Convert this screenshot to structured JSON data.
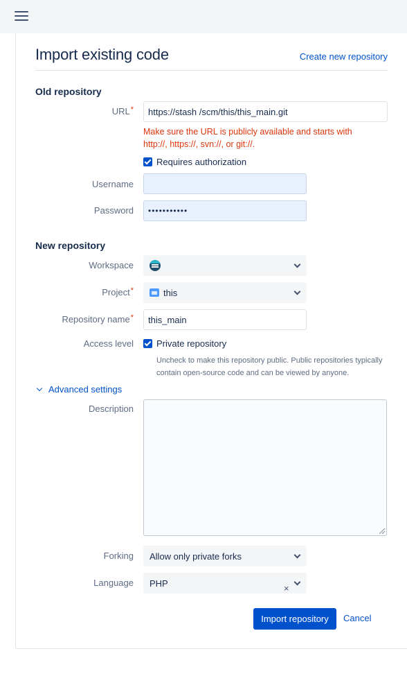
{
  "header": {
    "menu_icon": "hamburger-menu-icon"
  },
  "page": {
    "title": "Import existing code",
    "create_link": "Create new repository"
  },
  "old_repository": {
    "section_title": "Old repository",
    "url_label": "URL",
    "url_value": "https://stash        /scm/this/this_main.git",
    "error_text": "Make sure the URL is publicly available and starts with http://, https://, svn://, or git://.",
    "requires_auth_label": "Requires authorization",
    "requires_auth_checked": true,
    "username_label": "Username",
    "username_value": "",
    "password_label": "Password",
    "password_value": "•••••••••••"
  },
  "new_repository": {
    "section_title": "New repository",
    "workspace_label": "Workspace",
    "workspace_value": "",
    "project_label": "Project",
    "project_value": "this",
    "repo_name_label": "Repository name",
    "repo_name_value": "this_main",
    "access_label": "Access level",
    "private_label": "Private repository",
    "private_checked": true,
    "private_help": "Uncheck to make this repository public. Public repositories typically contain open-source code and can be viewed by anyone."
  },
  "advanced": {
    "toggle_label": "Advanced settings",
    "description_label": "Description",
    "description_value": "",
    "forking_label": "Forking",
    "forking_value": "Allow only private forks",
    "language_label": "Language",
    "language_value": "PHP",
    "clear_glyph": "×"
  },
  "actions": {
    "import_label": "Import repository",
    "cancel_label": "Cancel"
  },
  "colors": {
    "accent": "#0052cc",
    "error": "#de350b",
    "text": "#172b4d",
    "muted": "#5e6c84"
  }
}
